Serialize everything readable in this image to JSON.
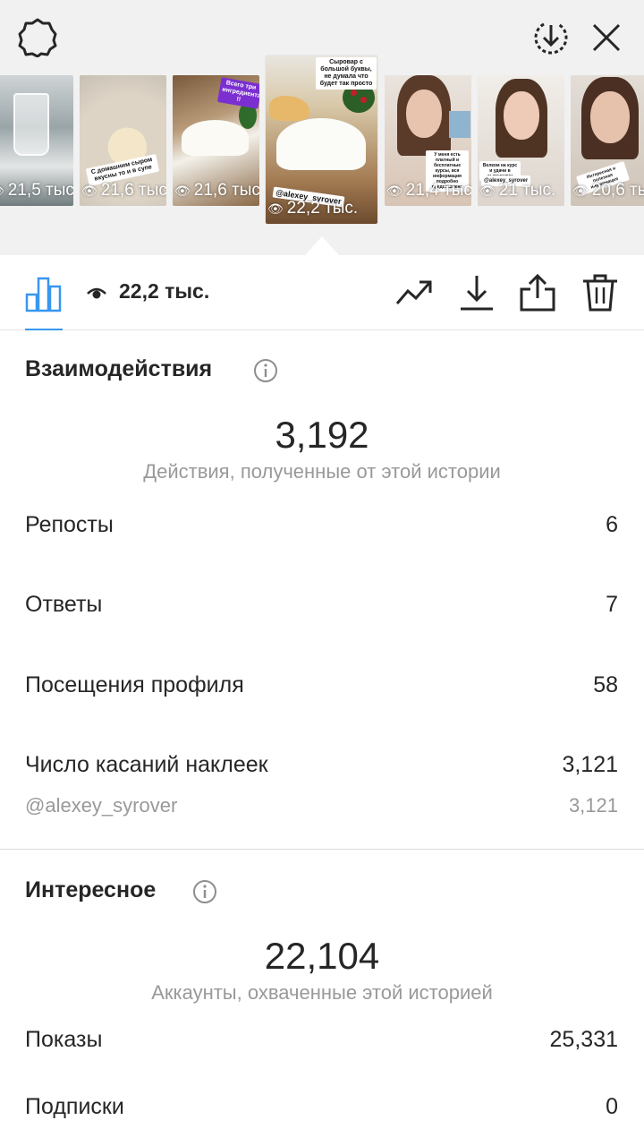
{
  "colors": {
    "accent": "#3897f0",
    "text": "#262626",
    "muted": "#999999",
    "panel": "#f1f1f1"
  },
  "top_bar": {
    "settings_icon": "gear-icon",
    "save_icon": "download-circle-icon",
    "close_icon": "close-icon"
  },
  "thumbnails": [
    {
      "views": "21,5 тыс.",
      "caption": ""
    },
    {
      "views": "21,6 тыс.",
      "caption": "С домашним сыром вкусны то и в супе"
    },
    {
      "views": "21,6 тыс.",
      "caption": "Всего три ингредиента !!"
    },
    {
      "views": "22,2 тыс.",
      "caption": "Сыровар с большой буквы, не думала что будет так просто",
      "sticker": "@alexey_syrover"
    },
    {
      "views": "21,4 тыс.",
      "caption": "У меня есть платный и бесплатные курсы, вся информация подробно представлена"
    },
    {
      "views": "21 тыс.",
      "caption": "Велком на курс и удачи в сыроделии",
      "sticker": "@alexey_syrover"
    },
    {
      "views": "20,6 тыс.",
      "caption": "Интересная и полезная информация"
    }
  ],
  "toolbar": {
    "insights_icon": "bar-chart-icon",
    "views": "22,2 тыс.",
    "trend_icon": "trending-up-icon",
    "download_icon": "download-icon",
    "share_icon": "share-icon",
    "delete_icon": "trash-icon"
  },
  "interactions": {
    "title": "Взаимодействия",
    "total": "3,192",
    "caption": "Действия, полученные от этой истории",
    "rows": [
      {
        "label": "Репосты",
        "value": "6"
      },
      {
        "label": "Ответы",
        "value": "7"
      },
      {
        "label": "Посещения профиля",
        "value": "58"
      },
      {
        "label": "Число касаний наклеек",
        "value": "3,121"
      }
    ],
    "sticker": {
      "label": "@alexey_syrover",
      "value": "3,121"
    }
  },
  "discovery": {
    "title": "Интересное",
    "total": "22,104",
    "caption": "Аккаунты, охваченные этой историей",
    "rows": [
      {
        "label": "Показы",
        "value": "25,331"
      },
      {
        "label": "Подписки",
        "value": "0"
      }
    ]
  }
}
